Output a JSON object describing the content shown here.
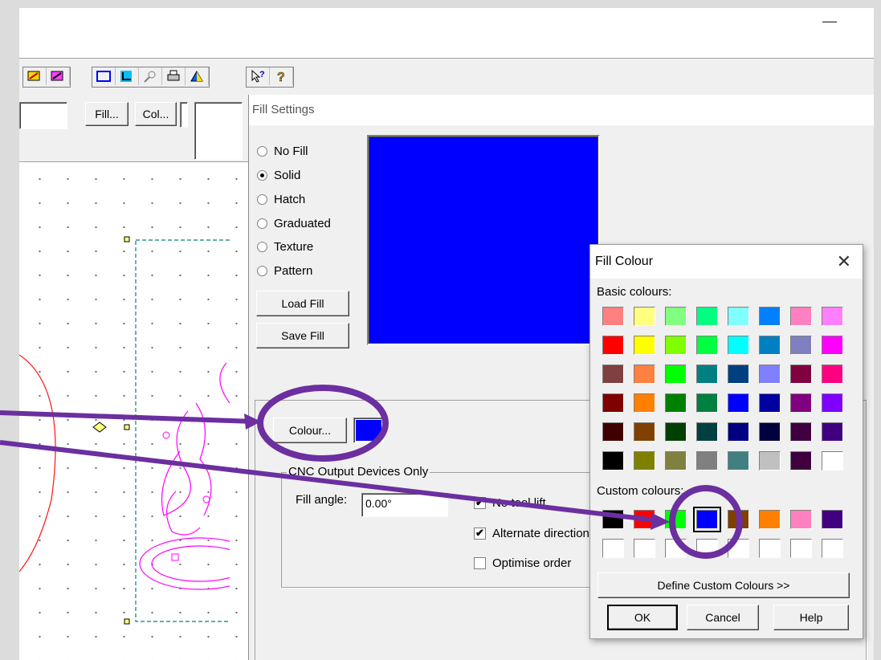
{
  "app": {
    "minimize_glyph": "—"
  },
  "toolbar": {
    "icons": [
      "fill-tool-icon",
      "fill-tool-2-icon",
      "rectangle-icon",
      "corner-icon",
      "zoom-icon",
      "print-icon",
      "render-icon",
      "whats-this-icon",
      "help-icon"
    ]
  },
  "propbar": {
    "fill_button": "Fill...",
    "col_button": "Col..."
  },
  "fill_settings": {
    "title": "Fill Settings",
    "options": [
      "No Fill",
      "Solid",
      "Hatch",
      "Graduated",
      "Texture",
      "Pattern"
    ],
    "selected_option": "Solid",
    "load_fill": "Load Fill",
    "save_fill": "Save Fill",
    "preview_color": "#0000ff",
    "colour_button": "Colour...",
    "colour_swatch": "#0000ff",
    "cnc_group": "CNC Output Devices Only",
    "fill_angle_label": "Fill angle:",
    "fill_angle_value": "0.00°",
    "no_tool_lift": "No tool lift",
    "no_tool_lift_checked": true,
    "alternate_direction": "Alternate direction",
    "alternate_direction_checked": true,
    "optimise_order": "Optimise order",
    "optimise_order_checked": false
  },
  "fill_colour": {
    "title": "Fill Colour",
    "close_glyph": "✕",
    "basic_label": "Basic colours:",
    "basic_colours": [
      "#ff8080",
      "#ffff80",
      "#80ff80",
      "#00ff80",
      "#80ffff",
      "#0080ff",
      "#ff80c0",
      "#ff80ff",
      "#ff0000",
      "#ffff00",
      "#80ff00",
      "#00ff40",
      "#00ffff",
      "#0080c0",
      "#8080c0",
      "#ff00ff",
      "#804040",
      "#ff8040",
      "#00ff00",
      "#008080",
      "#004080",
      "#8080ff",
      "#800040",
      "#ff0080",
      "#800000",
      "#ff8000",
      "#008000",
      "#008040",
      "#0000ff",
      "#0000a0",
      "#800080",
      "#8000ff",
      "#400000",
      "#804000",
      "#004000",
      "#004040",
      "#000080",
      "#000040",
      "#400040",
      "#400080",
      "#000000",
      "#808000",
      "#808040",
      "#808080",
      "#408080",
      "#c0c0c0",
      "#400040",
      "#ffffff"
    ],
    "custom_label": "Custom colours:",
    "custom_colours": [
      "#000000",
      "#ff0000",
      "#00ff00",
      "#0000ff",
      "#804000",
      "#ff8000",
      "#ff80c0",
      "#400080",
      "#ffffff",
      "#ffffff",
      "#ffffff",
      "#ffffff",
      "#ffffff",
      "#ffffff",
      "#ffffff",
      "#ffffff"
    ],
    "selected_custom_index": 3,
    "define_custom": "Define Custom Colours >>",
    "ok": "OK",
    "cancel": "Cancel",
    "help": "Help"
  },
  "annotation": {
    "color": "#6b2fa0"
  }
}
